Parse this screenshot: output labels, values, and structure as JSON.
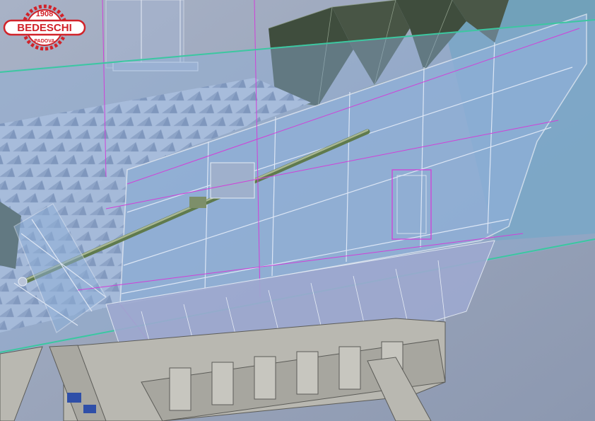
{
  "scene": {
    "kind": "cad-render",
    "colors": {
      "sky": "#9aa7bd",
      "transparent_shell": "#8fb0d8",
      "grid_plate": "#bcc6de",
      "dark_panel": "#3f4d3d",
      "steel_frame": "#b9b8b1",
      "green_edge": "#3cc7a0",
      "magenta_edge": "#d040d8",
      "white_edge": "#e6ecf5"
    }
  },
  "logo": {
    "year": "1908",
    "name": "BEDESCHI",
    "city": "PADOVA",
    "color": "#d1232a"
  }
}
